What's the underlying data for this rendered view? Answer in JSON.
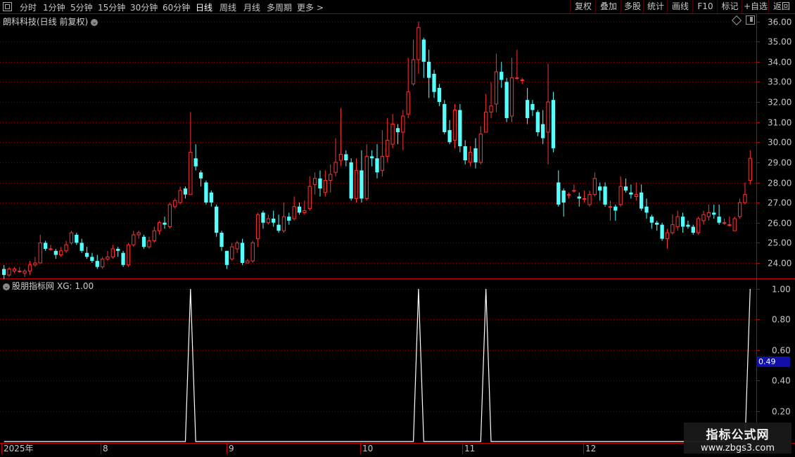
{
  "toolbar": {
    "left": [
      "分时",
      "1分钟",
      "5分钟",
      "15分钟",
      "30分钟",
      "60分钟",
      "日线",
      "周线",
      "月线",
      "多周期",
      "更多 >"
    ],
    "active": "日线",
    "right": [
      "复权",
      "叠加",
      "多股",
      "统计",
      "画线",
      "F10",
      "+自选",
      "返回",
      "标记"
    ]
  },
  "main": {
    "title": "朗科科技(日线 前复权)",
    "price_ticks": [
      "36.00",
      "35.00",
      "34.00",
      "33.00",
      "32.00",
      "31.00",
      "30.00",
      "29.00",
      "28.00",
      "27.00",
      "26.00",
      "25.00",
      "24.00"
    ]
  },
  "indicator": {
    "name": "股朋指标网",
    "xg_label": "XG: 1.00",
    "ticks": [
      "1.00",
      "0.80",
      "0.60",
      "0.40",
      "0.20"
    ],
    "cursor_value": "0.49"
  },
  "date_axis": [
    "2025年",
    "8",
    "9",
    "10",
    "11",
    "12"
  ],
  "watermark": {
    "line1": "指标公式网",
    "line2": "www.zbgs3.com"
  },
  "colors": {
    "up": "#ff3232",
    "down": "#54ffff",
    "grid": "#7a0000",
    "border": "#a00000"
  },
  "chart_data": [
    {
      "type": "candlestick",
      "title": "朗科科技(日线 前复权)",
      "ylim": [
        23.3,
        36.3
      ],
      "candles": [
        [
          23.7,
          23.4,
          23.9,
          23.2
        ],
        [
          23.4,
          23.7,
          23.8,
          23.3
        ],
        [
          23.6,
          23.7,
          23.8,
          23.5
        ],
        [
          23.6,
          23.6,
          23.8,
          23.5
        ],
        [
          23.5,
          23.6,
          23.7,
          23.3
        ],
        [
          23.6,
          23.9,
          24.1,
          23.4
        ],
        [
          23.9,
          24.0,
          24.3,
          23.8
        ],
        [
          24.0,
          25.0,
          25.4,
          24.0
        ],
        [
          25.0,
          24.7,
          25.1,
          24.6
        ],
        [
          24.7,
          24.7,
          24.9,
          24.6
        ],
        [
          24.6,
          24.4,
          24.7,
          24.2
        ],
        [
          24.4,
          24.6,
          24.8,
          24.3
        ],
        [
          24.6,
          24.9,
          25.1,
          24.5
        ],
        [
          25.0,
          25.5,
          25.6,
          24.9
        ],
        [
          25.4,
          25.0,
          25.5,
          24.9
        ],
        [
          25.0,
          24.6,
          25.2,
          24.5
        ],
        [
          24.5,
          24.3,
          24.8,
          24.2
        ],
        [
          24.3,
          24.1,
          24.5,
          24.0
        ],
        [
          24.1,
          23.8,
          24.4,
          23.7
        ],
        [
          23.8,
          24.2,
          24.3,
          23.7
        ],
        [
          24.2,
          24.3,
          24.6,
          24.1
        ],
        [
          24.3,
          24.7,
          24.9,
          24.2
        ],
        [
          24.7,
          24.6,
          24.8,
          24.3
        ],
        [
          24.5,
          23.9,
          24.6,
          23.8
        ],
        [
          23.9,
          24.9,
          25.0,
          23.8
        ],
        [
          24.9,
          25.4,
          25.6,
          24.8
        ],
        [
          25.4,
          25.5,
          25.6,
          25.2
        ],
        [
          25.3,
          24.8,
          25.4,
          24.7
        ],
        [
          24.8,
          25.1,
          25.3,
          24.7
        ],
        [
          25.1,
          25.6,
          25.8,
          25.0
        ],
        [
          25.6,
          26.0,
          26.1,
          25.4
        ],
        [
          26.0,
          25.9,
          26.3,
          25.7
        ],
        [
          25.8,
          26.9,
          27.0,
          25.7
        ],
        [
          26.8,
          27.1,
          27.2,
          26.7
        ],
        [
          27.0,
          27.6,
          27.8,
          26.9
        ],
        [
          27.7,
          27.4,
          27.8,
          27.2
        ],
        [
          27.4,
          29.5,
          31.5,
          27.4
        ],
        [
          29.2,
          28.8,
          29.9,
          28.6
        ],
        [
          28.5,
          28.2,
          28.6,
          27.8
        ],
        [
          28.0,
          27.0,
          28.1,
          26.9
        ],
        [
          27.5,
          27.0,
          27.6,
          26.8
        ],
        [
          26.8,
          25.5,
          26.9,
          25.3
        ],
        [
          25.5,
          24.8,
          25.6,
          24.6
        ],
        [
          24.6,
          23.9,
          24.6,
          23.7
        ],
        [
          24.2,
          24.8,
          25.0,
          24.1
        ],
        [
          24.7,
          25.0,
          25.1,
          24.5
        ],
        [
          25.0,
          24.0,
          25.2,
          23.9
        ],
        [
          24.0,
          24.1,
          24.2,
          24.0
        ],
        [
          24.1,
          25.0,
          25.1,
          24.0
        ],
        [
          25.2,
          26.4,
          26.5,
          24.8
        ],
        [
          26.5,
          26.0,
          26.6,
          25.7
        ],
        [
          26.0,
          26.2,
          26.4,
          25.9
        ],
        [
          26.2,
          26.0,
          26.6,
          25.8
        ],
        [
          25.9,
          25.6,
          26.4,
          25.5
        ],
        [
          25.6,
          26.3,
          27.0,
          25.5
        ],
        [
          26.3,
          26.1,
          26.5,
          25.9
        ],
        [
          26.2,
          26.8,
          27.3,
          26.1
        ],
        [
          26.8,
          26.5,
          27.0,
          26.4
        ],
        [
          26.5,
          26.6,
          27.1,
          26.4
        ],
        [
          26.7,
          27.8,
          28.3,
          26.6
        ],
        [
          27.9,
          28.2,
          28.5,
          27.4
        ],
        [
          28.2,
          27.7,
          28.6,
          27.3
        ],
        [
          27.5,
          28.1,
          28.6,
          27.3
        ],
        [
          28.1,
          28.4,
          28.9,
          27.5
        ],
        [
          28.5,
          29.0,
          30.2,
          28.3
        ],
        [
          29.1,
          29.4,
          31.7,
          28.8
        ],
        [
          29.4,
          29.1,
          29.6,
          28.8
        ],
        [
          29.0,
          27.2,
          29.2,
          27.1
        ],
        [
          27.2,
          28.6,
          29.2,
          27.0
        ],
        [
          28.6,
          27.2,
          29.6,
          27.0
        ],
        [
          27.2,
          29.3,
          29.9,
          27.1
        ],
        [
          29.3,
          29.2,
          29.6,
          28.8
        ],
        [
          29.2,
          28.5,
          29.9,
          28.2
        ],
        [
          28.6,
          29.3,
          30.6,
          28.3
        ],
        [
          29.3,
          30.1,
          31.2,
          29.0
        ],
        [
          29.9,
          30.9,
          31.4,
          29.7
        ],
        [
          30.7,
          30.5,
          30.9,
          29.9
        ],
        [
          30.5,
          31.3,
          31.6,
          29.6
        ],
        [
          31.4,
          32.5,
          34.2,
          31.2
        ],
        [
          32.9,
          34.1,
          35.1,
          32.8
        ],
        [
          34.1,
          35.7,
          36.0,
          33.4
        ],
        [
          35.1,
          34.0,
          35.2,
          33.2
        ],
        [
          34.0,
          33.2,
          34.6,
          32.2
        ],
        [
          33.4,
          32.5,
          33.6,
          32.2
        ],
        [
          32.7,
          32.0,
          32.9,
          31.8
        ],
        [
          31.9,
          30.5,
          32.1,
          30.4
        ],
        [
          30.6,
          30.0,
          31.1,
          29.9
        ],
        [
          30.1,
          31.6,
          31.9,
          29.7
        ],
        [
          31.6,
          29.8,
          31.9,
          29.5
        ],
        [
          29.8,
          29.1,
          30.1,
          28.9
        ],
        [
          29.0,
          29.5,
          29.8,
          28.8
        ],
        [
          29.7,
          29.0,
          30.2,
          28.7
        ],
        [
          29.0,
          30.4,
          30.8,
          28.9
        ],
        [
          30.5,
          31.5,
          32.4,
          30.5
        ],
        [
          31.5,
          31.8,
          33.0,
          31.2
        ],
        [
          31.9,
          33.5,
          34.4,
          31.5
        ],
        [
          33.5,
          33.1,
          34.0,
          32.7
        ],
        [
          33.0,
          31.2,
          33.2,
          31.0
        ],
        [
          31.3,
          33.2,
          34.2,
          31.0
        ],
        [
          33.2,
          33.2,
          34.6,
          33.1
        ],
        [
          33.1,
          33.1,
          33.2,
          32.9
        ],
        [
          32.1,
          31.2,
          32.7,
          30.9
        ],
        [
          31.9,
          31.6,
          32.1,
          31.3
        ],
        [
          31.5,
          30.5,
          31.6,
          30.3
        ],
        [
          30.9,
          30.2,
          31.6,
          29.9
        ],
        [
          30.5,
          32.0,
          33.9,
          28.9
        ],
        [
          32.1,
          29.7,
          32.5,
          29.5
        ],
        [
          28.0,
          26.9,
          28.6,
          26.8
        ],
        [
          27.6,
          27.0,
          27.7,
          26.3
        ],
        [
          27.4,
          27.4,
          27.5,
          27.2
        ],
        [
          27.6,
          27.6,
          27.9,
          27.5
        ],
        [
          27.3,
          27.2,
          27.5,
          26.8
        ],
        [
          27.2,
          27.2,
          27.6,
          27.0
        ],
        [
          26.9,
          27.4,
          27.6,
          26.8
        ],
        [
          27.4,
          28.2,
          28.5,
          27.3
        ],
        [
          27.8,
          27.6,
          28.0,
          27.1
        ],
        [
          27.8,
          26.9,
          28.0,
          26.8
        ],
        [
          26.8,
          26.8,
          27.1,
          26.1
        ],
        [
          26.8,
          26.6,
          26.9,
          26.1
        ],
        [
          26.9,
          27.8,
          28.3,
          26.8
        ],
        [
          27.8,
          27.6,
          28.2,
          27.5
        ],
        [
          27.5,
          27.4,
          27.9,
          27.2
        ],
        [
          27.3,
          27.4,
          28.0,
          27.1
        ],
        [
          27.5,
          26.7,
          27.9,
          26.6
        ],
        [
          26.8,
          26.5,
          27.2,
          26.2
        ],
        [
          26.3,
          26.0,
          26.4,
          25.7
        ],
        [
          26.0,
          25.9,
          26.1,
          25.6
        ],
        [
          25.9,
          25.2,
          26.0,
          25.1
        ],
        [
          25.2,
          25.5,
          25.7,
          24.7
        ],
        [
          25.5,
          25.9,
          26.4,
          25.4
        ],
        [
          25.8,
          26.3,
          26.6,
          25.6
        ],
        [
          26.3,
          25.8,
          26.5,
          25.5
        ],
        [
          25.9,
          25.8,
          26.1,
          25.7
        ],
        [
          25.8,
          25.5,
          25.9,
          25.4
        ],
        [
          25.5,
          26.2,
          26.3,
          25.4
        ],
        [
          26.1,
          26.4,
          26.6,
          25.9
        ],
        [
          26.3,
          26.5,
          26.9,
          26.1
        ],
        [
          26.5,
          26.4,
          26.9,
          26.2
        ],
        [
          26.3,
          26.0,
          26.9,
          25.9
        ],
        [
          26.0,
          26.0,
          26.2,
          25.9
        ],
        [
          25.9,
          25.9,
          26.3,
          25.8
        ],
        [
          25.6,
          26.2,
          26.3,
          25.6
        ],
        [
          26.3,
          27.0,
          27.2,
          26.2
        ],
        [
          27.0,
          27.4,
          28.0,
          26.9
        ],
        [
          28.1,
          29.2,
          29.6,
          27.9
        ]
      ]
    },
    {
      "type": "line",
      "series": [
        {
          "name": "XG",
          "values": [
            0,
            0,
            0,
            0,
            0,
            0,
            0,
            0,
            0,
            0,
            0,
            0,
            0,
            0,
            0,
            0,
            0,
            0,
            0,
            0,
            0,
            0,
            0,
            0,
            0,
            0,
            0,
            0,
            0,
            0,
            0,
            0,
            0,
            0,
            0,
            0,
            1,
            0,
            0,
            0,
            0,
            0,
            0,
            0,
            0,
            0,
            0,
            0,
            0,
            0,
            0,
            0,
            0,
            0,
            0,
            0,
            0,
            0,
            0,
            0,
            0,
            0,
            0,
            0,
            0,
            0,
            0,
            0,
            0,
            0,
            0,
            0,
            0,
            0,
            0,
            0,
            0,
            0,
            0,
            0,
            1,
            0,
            0,
            0,
            0,
            0,
            0,
            0,
            0,
            0,
            0,
            0,
            0,
            1,
            0,
            0,
            0,
            0,
            0,
            0,
            0,
            0,
            0,
            0,
            0,
            0,
            0,
            0,
            0,
            0,
            0,
            0,
            0,
            0,
            0,
            0,
            0,
            0,
            0,
            0,
            0,
            0,
            0,
            0,
            0,
            0,
            0,
            0,
            0,
            0,
            0,
            0,
            0,
            0,
            0,
            0,
            0,
            0,
            0,
            0,
            0,
            0,
            0,
            0,
            1
          ]
        }
      ],
      "ylim": [
        0,
        1.05
      ]
    }
  ]
}
